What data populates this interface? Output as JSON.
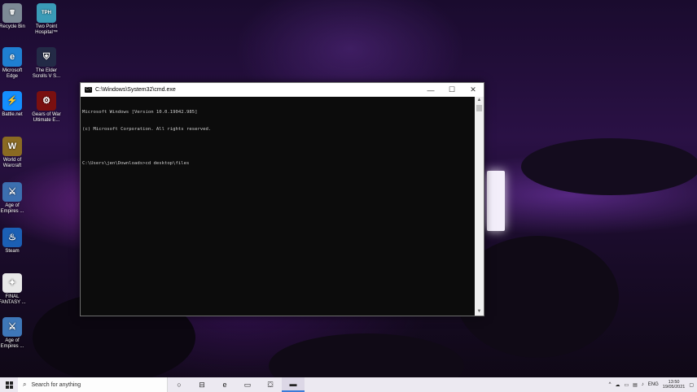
{
  "desktop_icons": [
    {
      "label": "Recycle Bin",
      "icon": "recycle-bin-icon",
      "color": "#7d8a96",
      "glyph": "🗑"
    },
    {
      "label": "Two Point\nHospital™",
      "icon": "two-point-hospital-icon",
      "color": "#3a9bb7",
      "glyph": "TPH"
    },
    {
      "label": "Microsoft\nEdge",
      "icon": "edge-icon",
      "color": "#1f7fd1",
      "glyph": "e"
    },
    {
      "label": "The Elder\nScrolls V S...",
      "icon": "skyrim-icon",
      "color": "#232a46",
      "glyph": "⛨"
    },
    {
      "label": "Battle.net",
      "icon": "battlenet-icon",
      "color": "#148eff",
      "glyph": "⚡"
    },
    {
      "label": "Gears of War\nUltimate E...",
      "icon": "gears-of-war-icon",
      "color": "#7a1010",
      "glyph": "⚙"
    },
    {
      "label": "World of\nWarcraft",
      "icon": "world-of-warcraft-icon",
      "color": "#8a6a22",
      "glyph": "W"
    },
    {
      "label": "Age of\nEmpires ...",
      "icon": "age-of-empires-icon",
      "color": "#3c6fb0",
      "glyph": "⚔"
    },
    {
      "label": "Steam",
      "icon": "steam-icon",
      "color": "#1b5fb4",
      "glyph": "♨"
    },
    {
      "label": "FINAL\nFANTASY ...",
      "icon": "final-fantasy-icon",
      "color": "#e8e8e8",
      "glyph": "✦"
    },
    {
      "label": "Age of\nEmpires ...",
      "icon": "age-of-empires-2-icon",
      "color": "#3e77b8",
      "glyph": "⚔"
    }
  ],
  "cmd_window": {
    "title": "C:\\Windows\\System32\\cmd.exe",
    "minimize": "—",
    "maximize": "☐",
    "close": "✕",
    "lines": [
      "Microsoft Windows [Version 10.0.19042.985]",
      "(c) Microsoft Corporation. All rights reserved.",
      "",
      "C:\\Users\\jen\\Downloads>cd desktop\\files"
    ]
  },
  "taskbar": {
    "search_placeholder": "Search for anything",
    "apps": [
      {
        "name": "task-view-icon",
        "glyph": "○"
      },
      {
        "name": "widgets-icon",
        "glyph": "⊟"
      },
      {
        "name": "edge-taskbar-icon",
        "glyph": "e"
      },
      {
        "name": "file-explorer-icon",
        "glyph": "▭"
      },
      {
        "name": "store-icon",
        "glyph": "⛋"
      },
      {
        "name": "cmd-taskbar-icon",
        "glyph": "▬",
        "active": true
      }
    ],
    "tray": {
      "language": "ENG",
      "time": "13:50",
      "date": "19/05/2021"
    }
  }
}
